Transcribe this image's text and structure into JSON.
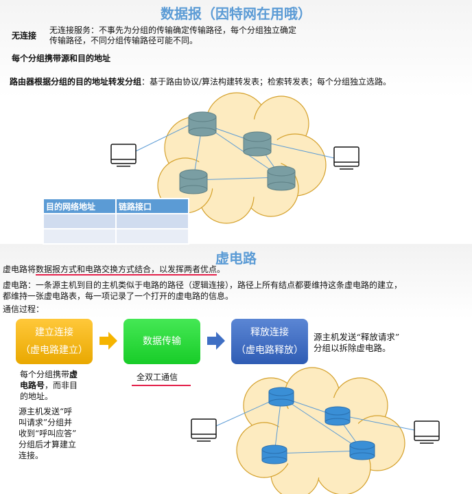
{
  "datagram": {
    "title": "数据报（因特网在用哦）",
    "connectionless_label": "无连接",
    "connectionless_desc_1": "无连接服务：不事先为分组的传输确定传输路径，每个分组独立确定",
    "connectionless_desc_2": "传输路径，不同分组传输路径可能不同。",
    "addr_note": "每个分组携带源和目的地址",
    "router_note_bold": "路由器根据分组的目的地址转发分组",
    "router_note_rest": "：基于路由协议/算法构建转发表；检索转发表；每个分组独立选路。",
    "table": {
      "headers": [
        "目的网络地址",
        "链路接口"
      ],
      "rows": [
        [
          "",
          ""
        ],
        [
          "",
          ""
        ]
      ]
    }
  },
  "vc": {
    "title": "虚电路",
    "line1_pre": "虚电路将",
    "line1_ul": "数据报方式和电路交换方式结合，以发挥两者优点",
    "line1_post": "。",
    "line2": "虚电路：一条源主机到目的主机类似于电路的路径（逻辑连接），路径上所有结点都要维持这条虚电路的建立，",
    "line3": "都维持一张虚电路表，每一项记录了一个打开的虚电路的信息。",
    "process_label": "通信过程：",
    "steps": [
      {
        "l1": "建立连接",
        "l2": "（虚电路建立）",
        "color": "#f5b400"
      },
      {
        "l1": "数据传输",
        "color": "#22cc33"
      },
      {
        "l1": "释放连接",
        "l2": "（虚电路释放）",
        "color": "#3f6fc4"
      }
    ],
    "release_note_1": "源主机发送“释放请求”",
    "release_note_2": "分组以拆除虚电路。",
    "full_duplex": "全双工通信",
    "vc_note_1": "每个分组携带",
    "vc_note_bold_1": "虚",
    "vc_note_bold_2": "电路号",
    "vc_note_2": "，而非目",
    "vc_note_3": "的地址。",
    "setup_note": [
      "源主机发送“呼",
      "叫请求”分组并",
      "收到“呼叫应答”",
      "分组后才算建立",
      "连接。"
    ]
  }
}
